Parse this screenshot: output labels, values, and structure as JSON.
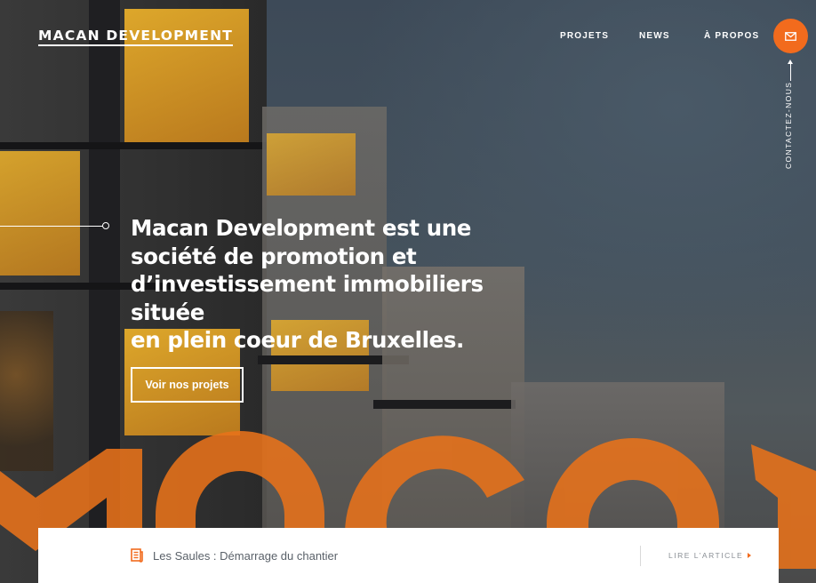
{
  "brand": {
    "name": "MACAN DEVELOPMENT",
    "accent_color": "#f26b1d"
  },
  "nav": {
    "items": [
      {
        "label": "PROJETS"
      },
      {
        "label": "NEWS"
      },
      {
        "label": "À PROPOS"
      }
    ],
    "contact_icon": "mail-icon",
    "contact_label": "CONTACTEZ-NOUS"
  },
  "hero": {
    "headline_lines": [
      "Macan Development est une",
      "société de promotion et",
      "d’investissement immobiliers située",
      "en plein coeur de Bruxelles."
    ],
    "cta_label": "Voir nos projets",
    "background": "building-photo"
  },
  "news": {
    "icon": "news-article-icon",
    "title": "Les Saules : Démarrage du chantier",
    "link_label": "LIRE L’ARTICLE",
    "link_icon": "caret-right-icon"
  }
}
